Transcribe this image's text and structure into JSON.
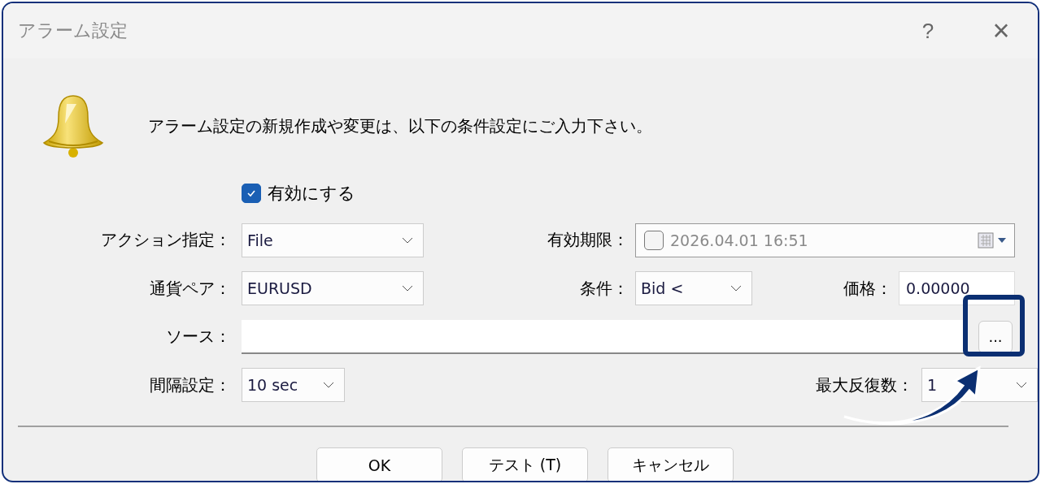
{
  "window": {
    "title": "アラーム設定",
    "help": "?",
    "close": "×"
  },
  "message": "アラーム設定の新規作成や変更は、以下の条件設定にご入力下さい。",
  "enable": {
    "label": "有効にする",
    "checked": true
  },
  "action": {
    "label": "アクション指定：",
    "value": "File"
  },
  "expiry": {
    "label": "有効期限：",
    "checked": false,
    "value": "2026.04.01 16:51"
  },
  "symbol": {
    "label": "通貨ペア：",
    "value": "EURUSD"
  },
  "condition": {
    "label": "条件：",
    "value": "Bid <"
  },
  "price": {
    "label": "価格：",
    "value": "0.00000"
  },
  "source": {
    "label": "ソース：",
    "browse": "..."
  },
  "interval": {
    "label": "間隔設定：",
    "value": "10 sec"
  },
  "max_repeats": {
    "label": "最大反復数：",
    "value": "1"
  },
  "buttons": [
    "OK",
    "テスト (T)",
    "キャンセル"
  ]
}
